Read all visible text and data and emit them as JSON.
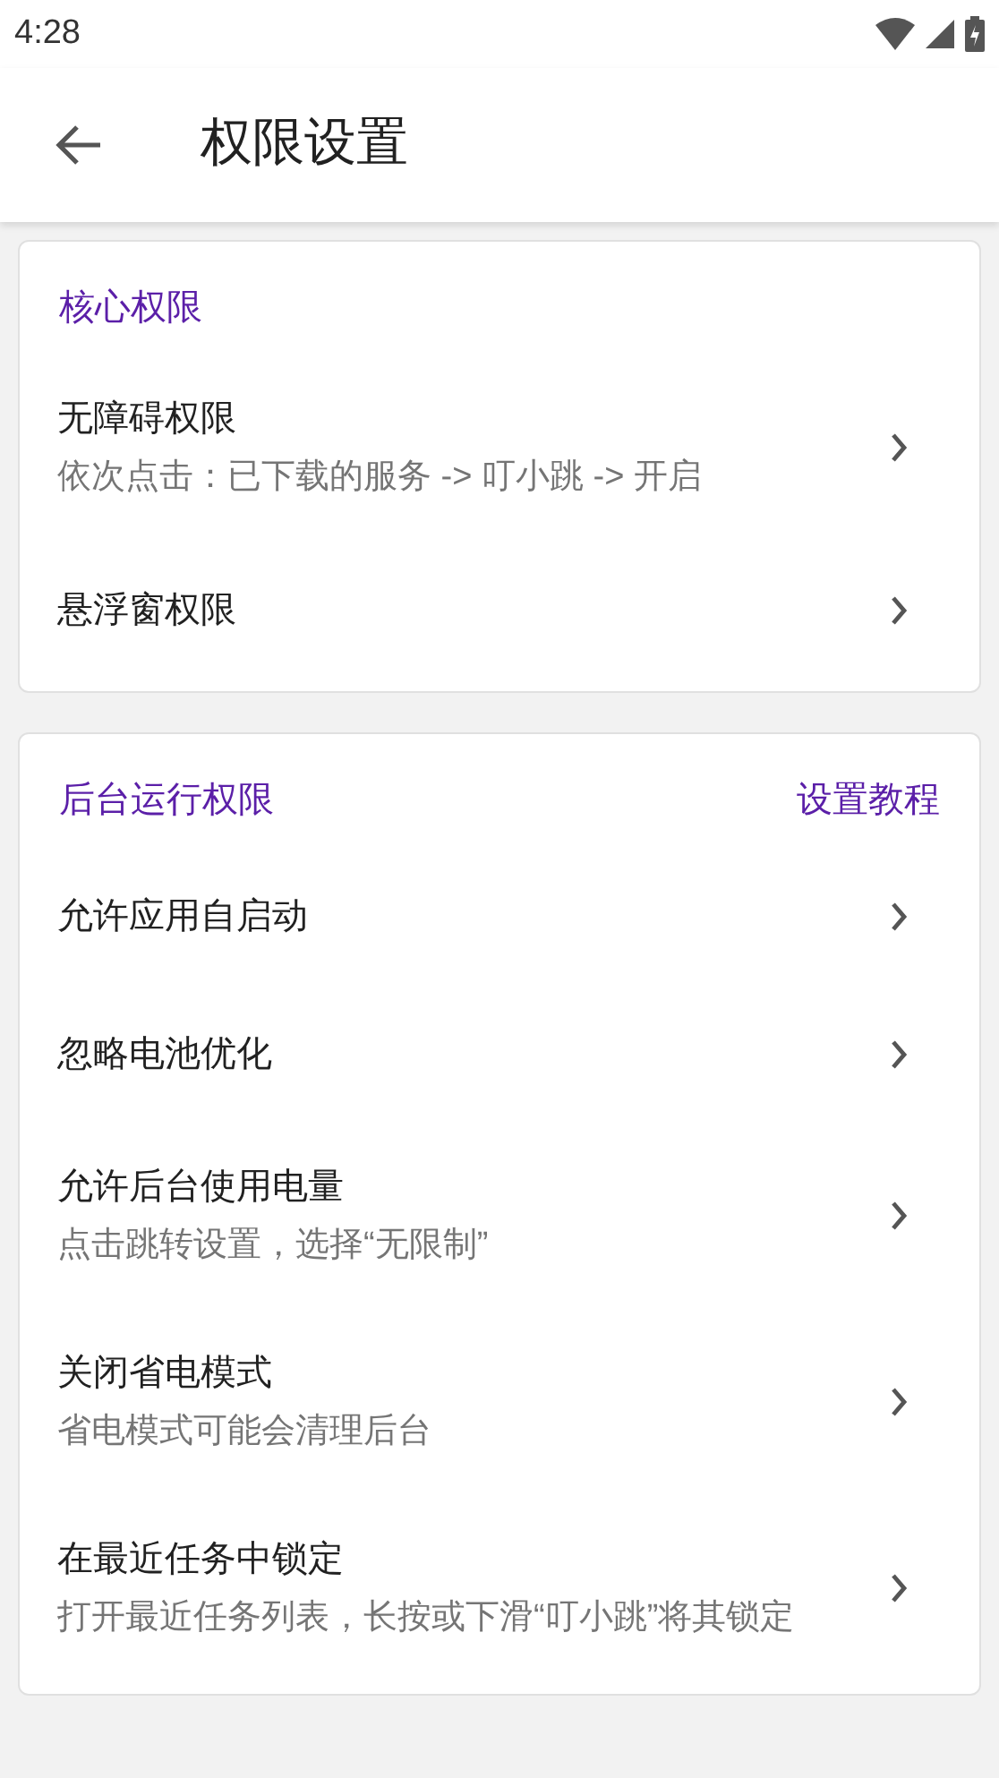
{
  "status_bar": {
    "time": "4:28"
  },
  "app_bar": {
    "title": "权限设置"
  },
  "sections": [
    {
      "title": "核心权限",
      "items": [
        {
          "title": "无障碍权限",
          "subtitle": "依次点击：已下载的服务 -> 叮小跳 -> 开启"
        },
        {
          "title": "悬浮窗权限"
        }
      ]
    },
    {
      "title": "后台运行权限",
      "action": "设置教程",
      "items": [
        {
          "title": "允许应用自启动"
        },
        {
          "title": "忽略电池优化"
        },
        {
          "title": "允许后台使用电量",
          "subtitle": "点击跳转设置，选择“无限制”"
        },
        {
          "title": "关闭省电模式",
          "subtitle": "省电模式可能会清理后台"
        },
        {
          "title": "在最近任务中锁定",
          "subtitle": "打开最近任务列表，长按或下滑“叮小跳”将其锁定"
        }
      ]
    }
  ]
}
